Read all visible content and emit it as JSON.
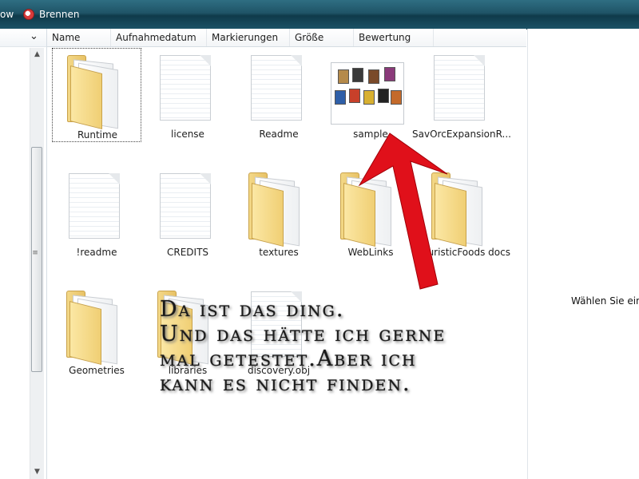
{
  "toolbar": {
    "item1": "ow",
    "burn": "Brennen"
  },
  "columns": [
    "Name",
    "Aufnahmedatum",
    "Markierungen",
    "Größe",
    "Bewertung"
  ],
  "items": [
    {
      "label": "Runtime",
      "type": "folder"
    },
    {
      "label": "license",
      "type": "doc"
    },
    {
      "label": "Readme",
      "type": "doc"
    },
    {
      "label": "sample",
      "type": "image"
    },
    {
      "label": "SavOrcExpansionR...",
      "type": "doc"
    },
    {
      "label": "!readme",
      "type": "doc"
    },
    {
      "label": "CREDITS",
      "type": "doc"
    },
    {
      "label": "textures",
      "type": "folder"
    },
    {
      "label": "WebLinks",
      "type": "folder"
    },
    {
      "label": "FuturisticFoods docs",
      "type": "folder"
    },
    {
      "label": "Geometries",
      "type": "folder"
    },
    {
      "label": "libraries",
      "type": "folder"
    },
    {
      "label": "discovery.obj",
      "type": "doc"
    }
  ],
  "preview_pane": {
    "text": "Wählen Sie eine"
  },
  "overlay": {
    "line1": "Da ist das ding.",
    "line2": "Und das hätte ich gerne",
    "line3": "mal getestet.Aber ich",
    "line4": "kann es nicht finden."
  },
  "colors": {
    "toolbar": "#1f5467",
    "arrow": "#e0101a",
    "folder": "#f0cf74"
  }
}
